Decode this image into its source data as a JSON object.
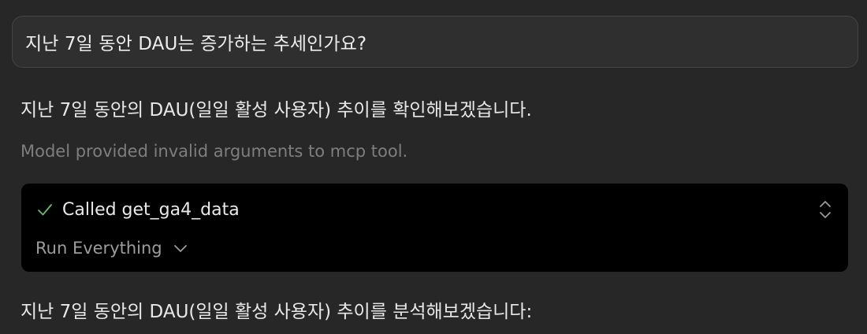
{
  "user_message": {
    "text": "지난 7일 동안 DAU는 증가하는 추세인가요?"
  },
  "assistant": {
    "intro_text": "지난 7일 동안의 DAU(일일 활성 사용자) 추이를 확인해보겠습니다.",
    "error_note": "Model provided invalid arguments to mcp tool.",
    "tool_call": {
      "status_icon": "check-icon",
      "title": "Called get_ga4_data",
      "run_label": "Run Everything",
      "expand_icon": "chevron-up-down-icon",
      "run_menu_icon": "chevron-down-icon"
    },
    "followup_text": "지난 7일 동안의 DAU(일일 활성 사용자) 추이를 분석해보겠습니다:"
  },
  "colors": {
    "background": "#272727",
    "check": "#5fbf6a",
    "muted": "#7e7e7e"
  }
}
